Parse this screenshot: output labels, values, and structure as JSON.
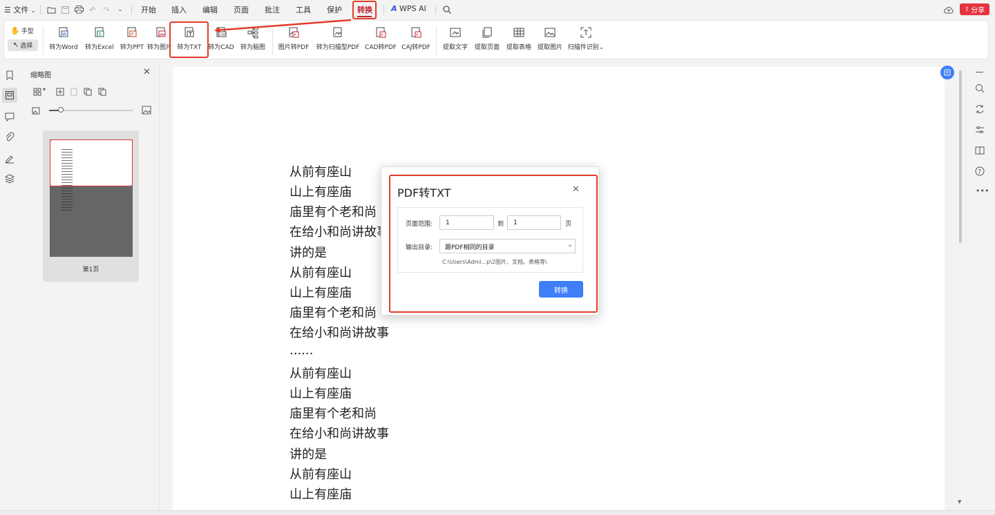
{
  "menubar": {
    "file_label": "文件",
    "tabs": [
      "开始",
      "插入",
      "编辑",
      "页面",
      "批注",
      "工具",
      "保护",
      "转换"
    ],
    "active_tab": "转换",
    "wps_ai_label": "WPS AI",
    "share_label": "分享"
  },
  "ribbon": {
    "hand_label": "手型",
    "select_label": "选择",
    "buttons": [
      "转为Word",
      "转为Excel",
      "转为PPT",
      "转为图片",
      "转为TXT",
      "转为CAD",
      "转为脑图",
      "图片转PDF",
      "转为扫描型PDF",
      "CAD转PDF",
      "CAJ转PDF",
      "提取文字",
      "提取页面",
      "提取表格",
      "提取图片",
      "扫描件识别"
    ],
    "highlighted": "转为TXT"
  },
  "thumbnail_panel": {
    "title": "缩略图",
    "page_label": "第1页"
  },
  "document": {
    "lines": [
      "从前有座山",
      "山上有座庙",
      "庙里有个老和尚",
      "在给小和尚讲故事",
      "讲的是",
      "从前有座山",
      "山上有座庙",
      "庙里有个老和尚",
      "在给小和尚讲故事",
      "......",
      "从前有座山",
      "山上有座庙",
      "庙里有个老和尚",
      "在给小和尚讲故事",
      "讲的是",
      "从前有座山",
      "山上有座庙"
    ]
  },
  "dialog": {
    "title": "PDF转TXT",
    "page_range_label": "页面范围:",
    "from_value": "1",
    "to_label": "到",
    "to_value": "1",
    "page_unit": "页",
    "output_label": "输出目录:",
    "output_selected": "跟PDF相同的目录",
    "output_path": "C:\\Users\\Admi...p\\2图片、文档、表格等\\",
    "convert_button": "转换"
  },
  "colors": {
    "accent_red": "#e23b2b",
    "primary_blue": "#3f7ef7",
    "share_red": "#e5333f"
  }
}
